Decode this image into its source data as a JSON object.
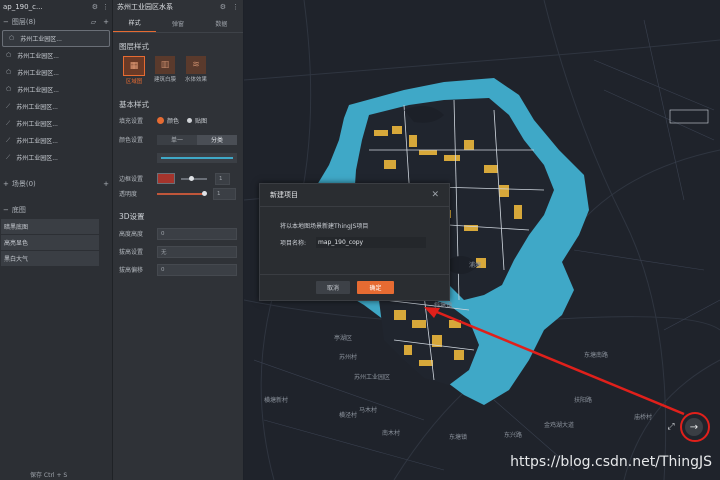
{
  "left_panel": {
    "project_title": "ap_190_c...",
    "layers_section": "图层(8)",
    "layers": [
      {
        "label": "苏州工业园区...",
        "icon": "polygon"
      },
      {
        "label": "苏州工业园区...",
        "icon": "polygon"
      },
      {
        "label": "苏州工业园区...",
        "icon": "polygon"
      },
      {
        "label": "苏州工业园区...",
        "icon": "polygon"
      },
      {
        "label": "苏州工业园区...",
        "icon": "line"
      },
      {
        "label": "苏州工业园区...",
        "icon": "line"
      },
      {
        "label": "苏州工业园区...",
        "icon": "line"
      },
      {
        "label": "苏州工业园区...",
        "icon": "line"
      }
    ],
    "scenes_section": "场景(0)",
    "basemap_section": "底图",
    "basemaps": [
      "暗黑底图",
      "高亮显色",
      "黑白大气"
    ],
    "footer": "保存 Ctrl + S"
  },
  "mid_panel": {
    "title": "苏州工业园区水系",
    "tabs": [
      "样式",
      "弹窗",
      "数据"
    ],
    "style_heading": "图层样式",
    "style_types": [
      "区域图",
      "建筑白膜",
      "水体效果"
    ],
    "basic_heading": "基本样式",
    "fill_label": "填充设置",
    "fill_options": [
      "颜色",
      "贴图"
    ],
    "color_label": "颜色设置",
    "color_modes": [
      "单一",
      "分类"
    ],
    "border_label": "边框设置",
    "border_value": "1",
    "opacity_label": "透明度",
    "opacity_value": "1",
    "d3_heading": "3D设置",
    "height_label": "高度高度",
    "height_value": "0",
    "extrude_label": "拔高设置",
    "extrude_value": "无",
    "extrude_offset_label": "拔高偏移",
    "extrude_offset_value": "0"
  },
  "dialog": {
    "title": "新建项目",
    "message": "将以本地图场景新建ThingJS项目",
    "name_label": "项目名称:",
    "name_value": "map_190_copy",
    "cancel": "取消",
    "ok": "确定"
  },
  "map_labels": [
    "苏州工业园区",
    "亭湖区",
    "苏州村",
    "浦塘",
    "马木村",
    "南木村",
    "东塘镇",
    "横泾村",
    "庙桥村",
    "斜塘镇",
    "东塘南路",
    "金鸡湖大道",
    "东兴路",
    "横塘新村",
    "扶阳路"
  ],
  "watermark": "https://blog.csdn.net/ThingJS",
  "colors": {
    "accent": "#e66b32",
    "water": "#3fa8c7",
    "building": "#d7a83a",
    "map_bg": "#1f232b",
    "arrow": "#e0201b"
  }
}
